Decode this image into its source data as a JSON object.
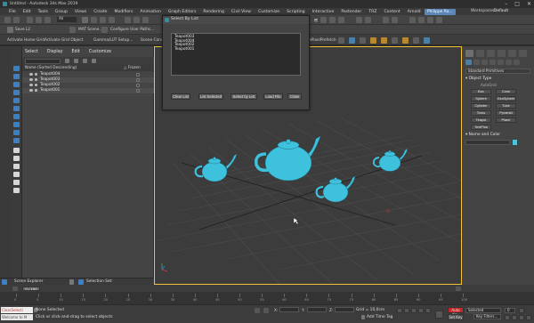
{
  "window": {
    "title": "Untitled - Autodesk 3ds Max 2019",
    "controls": [
      "–",
      "□",
      "✕"
    ]
  },
  "menu": {
    "items": [
      "File",
      "Edit",
      "Tools",
      "Group",
      "Views",
      "Create",
      "Modifiers",
      "Animation",
      "Graph Editors",
      "Rendering",
      "Civil View",
      "Customize",
      "Scripting",
      "Interactive",
      "Pastender",
      "TRZ",
      "Content",
      "Arnold",
      "Substance"
    ],
    "user": "Philippe Ra...",
    "workspace_label": "Workspaces:",
    "workspace_value": "Default"
  },
  "toolbar": {
    "filter_value": "All",
    "render_preset": "Save L2",
    "activate_home_grid": "Activate Home Grid",
    "activate_grid_object": "Activate Grid Object",
    "mat_scene": "MAT Scene...",
    "configure_user_paths": "Configure User Paths...",
    "gamma_lut_setup": "Gamma/LUT Setup...",
    "scene_convert": "Scene Conve",
    "pixel_prefetch": "sePixelPrefetch"
  },
  "scene_explorer": {
    "tabs": [
      "Select",
      "Display",
      "Edit",
      "Customize"
    ],
    "column_name": "Name (Sorted Descending)",
    "column_frozen": "△ Frozen",
    "rows": [
      "Teapot004",
      "Teapot003",
      "Teapot002",
      "Teapot001"
    ]
  },
  "dialog": {
    "title": "Select By List",
    "list_items": [
      "Teapot003",
      "Teapot004",
      "Teapot002",
      "Teapot001"
    ],
    "buttons": [
      "Clear List",
      "List Selected",
      "Select by List",
      "Load File",
      "Close"
    ]
  },
  "command_panel": {
    "dropdown": "Standard Primitives",
    "section_object_type": "▾ Object Type",
    "autogrid": "AutoGrid",
    "buttons": [
      "Box",
      "Cone",
      "Sphere",
      "GeoSphere",
      "Cylinder",
      "Tube",
      "Torus",
      "Pyramid",
      "Teapot",
      "Plane",
      "TextPlus"
    ],
    "section_name_color": "▾ Name and Color",
    "swatch_color": "#4fc3d8"
  },
  "scene_explorer_bar": {
    "label": "Scene Explorer",
    "selection_set": "Selection Set:"
  },
  "timeline": {
    "slider": "0 / 100",
    "ticks": [
      "0",
      "5",
      "10",
      "15",
      "20",
      "25",
      "30",
      "35",
      "40",
      "45",
      "50",
      "55",
      "60",
      "65",
      "70",
      "75",
      "80",
      "85",
      "90",
      "95",
      "100"
    ]
  },
  "status": {
    "maxscript_top": "ClearSelecti",
    "maxscript_bottom": "Welcome to M",
    "selection": "None Selected",
    "prompt": "Click or click-and-drag to select objects",
    "x_label": "X:",
    "y_label": "Y:",
    "z_label": "Z:",
    "grid": "Grid = 10,0cm",
    "add_time_tag": "Add Time Tag",
    "auto_key": "Auto Key",
    "set_key": "Set Key",
    "selected": "Selected",
    "key_filters": "Key Filters...",
    "frame": "0"
  },
  "colors": {
    "teapot": "#3ec1dc",
    "viewport_border": "#f1c232",
    "grid": "#4a4a4a"
  }
}
